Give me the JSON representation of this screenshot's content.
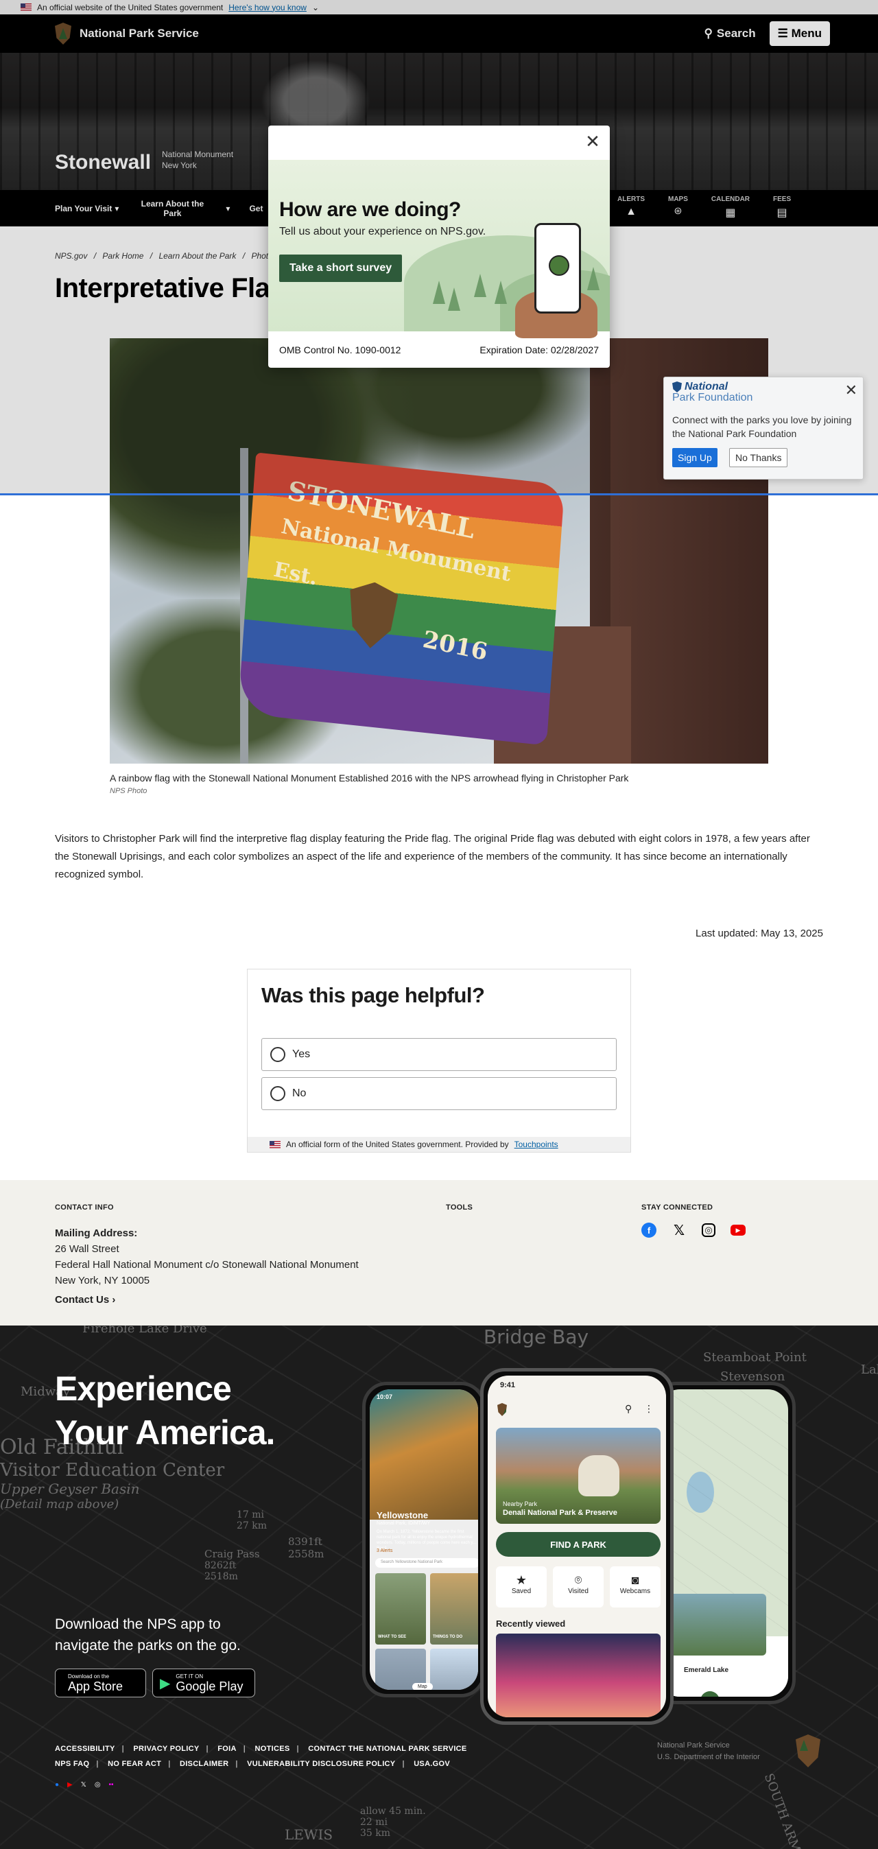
{
  "gov_banner": {
    "text": "An official website of the United States government",
    "link": "Here's how you know"
  },
  "header": {
    "brand": "National Park Service",
    "search_label": "Search",
    "menu_label": "Menu"
  },
  "park": {
    "name": "Stonewall",
    "designation": "National Monument",
    "state": "New York"
  },
  "nav": {
    "items": [
      "Plan Your Visit",
      "Learn About the Park",
      "Get"
    ],
    "icons": [
      {
        "label": "ALERTS",
        "icon": "alert-icon"
      },
      {
        "label": "MAPS",
        "icon": "map-pin-icon"
      },
      {
        "label": "CALENDAR",
        "icon": "calendar-icon"
      },
      {
        "label": "FEES",
        "icon": "fees-icon"
      }
    ]
  },
  "breadcrumb": [
    "NPS.gov",
    "/",
    "Park Home",
    "/",
    "Learn About the Park",
    "/",
    "Phot"
  ],
  "page_title": "Interpretative Flag",
  "photo": {
    "flag_text": [
      "STONEWALL",
      "National Monument",
      "Est.",
      "2016"
    ],
    "caption": "A rainbow flag with the Stonewall National Monument Established 2016 with the NPS arrowhead flying in Christopher Park",
    "credit": "NPS Photo"
  },
  "body_text": "Visitors to Christopher Park will find the interpretive flag display featuring the Pride flag. The original Pride flag was debuted with eight colors in 1978, a few years after the Stonewall Uprisings, and each color symbolizes an aspect of the life and experience of the members of the community. It has since become an internationally recognized symbol.",
  "last_updated": "Last updated: May 13, 2025",
  "helpful": {
    "title": "Was this page helpful?",
    "options": [
      "Yes",
      "No"
    ],
    "footer_text": "An official form of the United States government. Provided by",
    "footer_link": "Touchpoints"
  },
  "footer": {
    "contact_heading": "CONTACT INFO",
    "tools_heading": "TOOLS",
    "stay_heading": "STAY CONNECTED",
    "mailing_label": "Mailing Address:",
    "address": [
      "26 Wall Street",
      "Federal Hall National Monument c/o Stonewall National Monument",
      "New York, NY 10005"
    ],
    "contact_us": "Contact Us",
    "social": [
      "facebook-icon",
      "x-icon",
      "instagram-icon",
      "youtube-icon"
    ]
  },
  "experience": {
    "title_line1": "Experience",
    "title_line2": "Your America.",
    "download_line1": "Download the NPS app to",
    "download_line2": "navigate the parks on the go.",
    "app_store_small": "Download on the",
    "app_store": "App Store",
    "google_small": "GET IT ON",
    "google": "Google Play",
    "map_labels": [
      "Firehole Lake Drive",
      "Bridge Bay",
      "Steamboat Point",
      "Stevenson",
      "Old Faithful",
      "Visitor Education Center",
      "Upper Geyser Basin",
      "(Detail map above)",
      "Craig Pass",
      "8262ft",
      "2518m",
      "8391ft",
      "2558m",
      "17 mi",
      "27 km",
      "Midway",
      "Lake",
      "LEWIS",
      "SOUTH ARM",
      "allow 45 min.",
      "22 mi",
      "35 km"
    ],
    "phone_left": {
      "time": "10:07",
      "park": "Yellowstone",
      "park_sub": "National Park, ID/MT/WY",
      "body": "On March 1, 1872, Yellowstone became the first national park for all to enjoy the unique hydrothermal wonders. Today, millions of people come here each y... Read",
      "alerts": "3 Alerts",
      "search": "Search Yellowstone National Park",
      "tile1": "WHAT TO SEE",
      "tile2": "THINGS TO DO",
      "map": "Map"
    },
    "phone_mid": {
      "time": "9:41",
      "nearby": "Nearby Park",
      "park": "Denali National Park & Preserve",
      "find": "FIND A PARK",
      "tabs": [
        "Saved",
        "Visited",
        "Webcams"
      ],
      "recent": "Recently viewed"
    },
    "phone_right": {
      "lake": "Emerald Lake"
    },
    "links_row1": [
      "ACCESSIBILITY",
      "PRIVACY POLICY",
      "FOIA",
      "NOTICES",
      "CONTACT THE NATIONAL PARK SERVICE"
    ],
    "links_row2": [
      "NPS FAQ",
      "NO FEAR ACT",
      "DISCLAIMER",
      "VULNERABILITY DISCLOSURE POLICY",
      "USA.GOV"
    ],
    "agency1": "National Park Service",
    "agency2": "U.S. Department of the Interior"
  },
  "survey_modal": {
    "title": "How are we doing?",
    "subtitle": "Tell us about your experience on NPS.gov.",
    "button": "Take a short survey",
    "omb": "OMB Control No. 1090-0012",
    "expiration": "Expiration Date: 02/28/2027"
  },
  "npf_popup": {
    "logo_line1": "National",
    "logo_line2": "Park Foundation",
    "text": "Connect with the parks you love by joining the National Park Foundation",
    "signup": "Sign Up",
    "no_thanks": "No Thanks"
  },
  "colors": {
    "nps_black": "#000000",
    "survey_green": "#2e5a3a",
    "link_blue": "#005ea2",
    "npf_blue": "#1a6fd8",
    "accent_line": "#2f6fd6"
  }
}
